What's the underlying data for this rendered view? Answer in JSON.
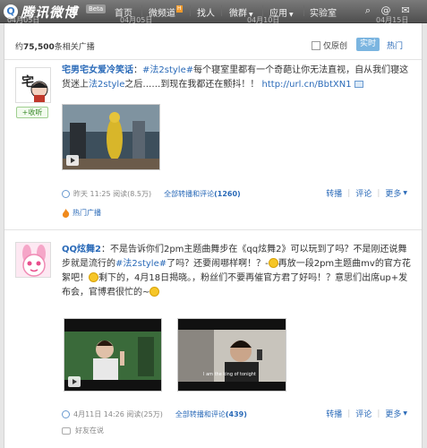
{
  "topbar": {
    "logo_glyph": "Q",
    "logo_text": "腾讯微博",
    "beta": "Beta",
    "nav": [
      {
        "label": "首页",
        "badge": ""
      },
      {
        "label": "微频道",
        "badge": "H"
      },
      {
        "label": "找人",
        "badge": ""
      },
      {
        "label": "微群",
        "badge": ""
      },
      {
        "label": "应用",
        "badge": ""
      },
      {
        "label": "实验室",
        "badge": ""
      }
    ],
    "ghost_dates": [
      "04月05日",
      "04月05日",
      "04月10日",
      "04月15日"
    ],
    "icons": [
      "search-icon",
      "at-icon",
      "mail-icon"
    ]
  },
  "filter": {
    "count_prefix": "约",
    "count_value": "75,500",
    "count_suffix": "条相关广播",
    "original_only": "仅原创",
    "realtime": "实时",
    "popular": "热门"
  },
  "posts": [
    {
      "author": "宅男宅女爱冷笑话",
      "text_parts": [
        "：",
        "#法2style#",
        "每个寝室里都有一个奇葩让你无法直视，自从我们寝这货迷上",
        "法2style",
        "之后……到现在我都还在颤抖！！",
        "http://url.cn/BbtXN1"
      ],
      "follow": "+收听",
      "meta": {
        "prefix": "昨天",
        "time": "11:25",
        "reads": "阅读(8.5万)",
        "all_label": "全部转播和评论",
        "all_count": "(1260)"
      },
      "actions": [
        "转播",
        "评论",
        "更多"
      ],
      "hot_label": "热门广播"
    },
    {
      "author": "QQ炫舞2",
      "text_parts": [
        "：",
        "不是告诉你们2pm主题曲舞步在《qq炫舞2》可以玩到了吗？不是刚还说舞步就是流行的",
        "#法2style#",
        "了吗？还要闹哪样啊！？-",
        "再放一段2pm主题曲mv的官方花絮吧！",
        "剩下的，4月18日揭晓。，粉丝们不要再催官方君了好吗！？意思们出席up+发布会，官博君很忙的~"
      ],
      "meta": {
        "prefix": "",
        "time": "4月11日 14:26",
        "reads": "阅读(25万)",
        "all_label": "全部转播和评论",
        "all_count": "(439)"
      },
      "video_caption": "I am the king of tonight",
      "actions": [
        "转播",
        "评论",
        "更多"
      ],
      "friend_label": "好友在说"
    }
  ],
  "colors": {
    "link": "#2a6ab8",
    "topbar": "#5a5a5a",
    "realtime_bg": "#7bb5e0"
  }
}
